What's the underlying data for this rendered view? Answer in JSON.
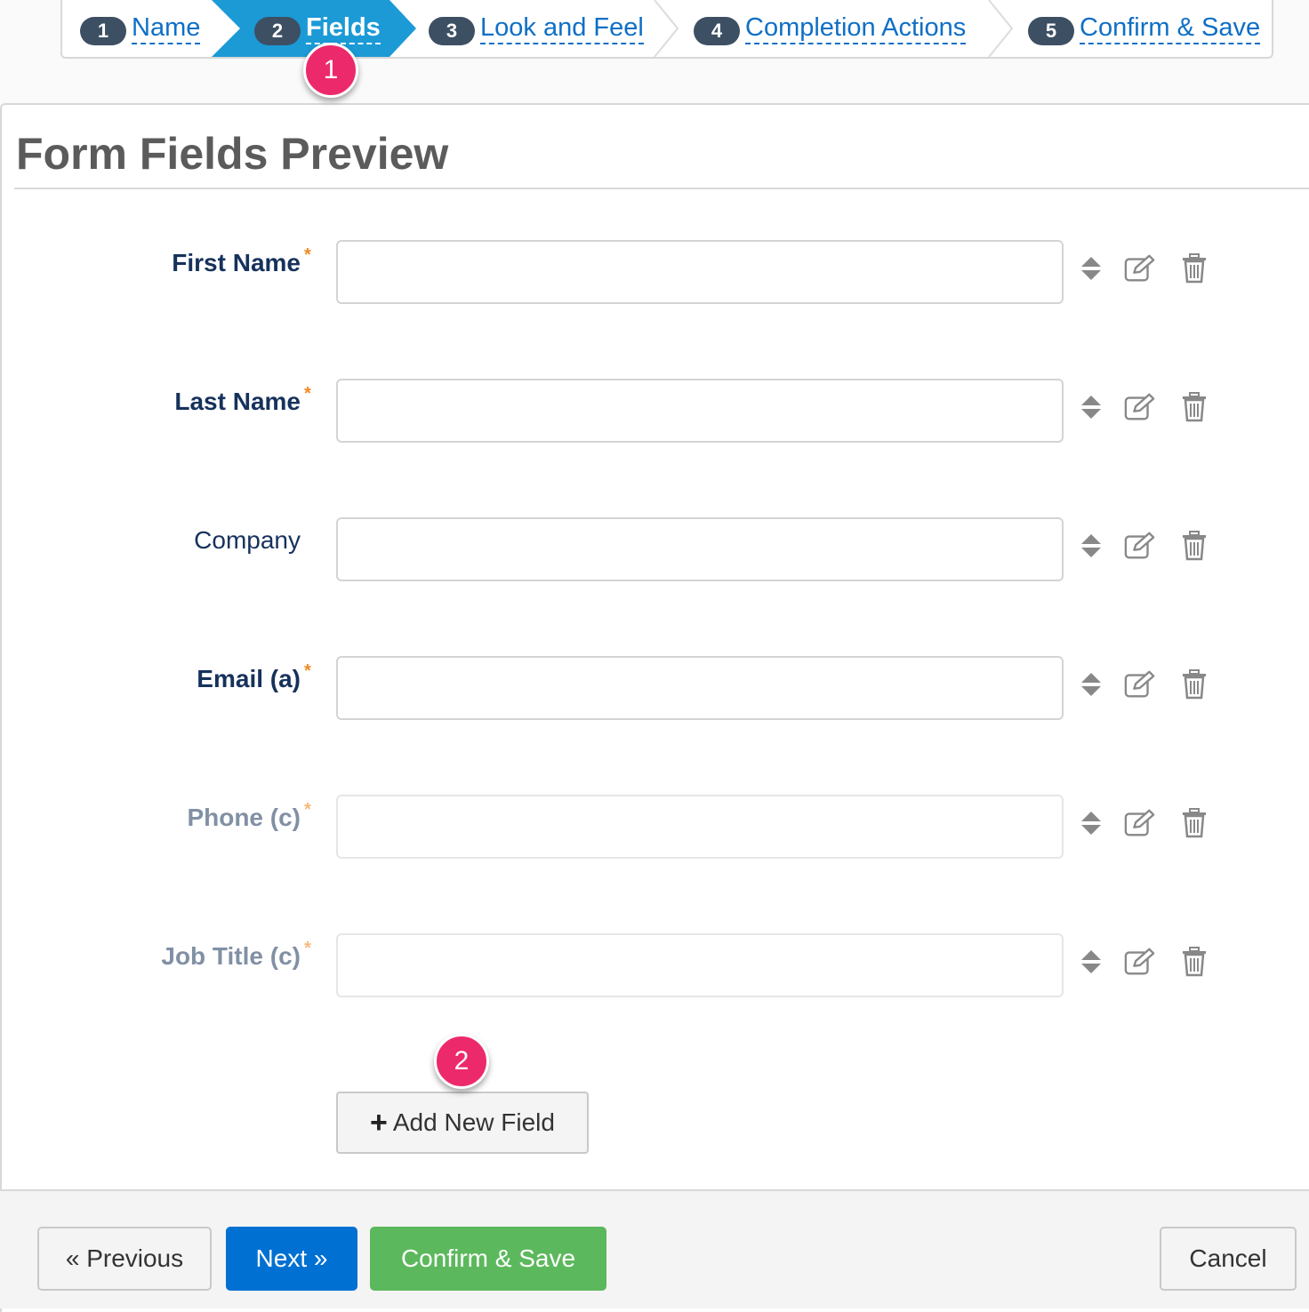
{
  "wizard": {
    "steps": [
      {
        "number": "1",
        "label": "Name"
      },
      {
        "number": "2",
        "label": "Fields"
      },
      {
        "number": "3",
        "label": "Look and Feel"
      },
      {
        "number": "4",
        "label": "Completion Actions"
      },
      {
        "number": "5",
        "label": "Confirm & Save"
      }
    ],
    "active_step": "2"
  },
  "callouts": {
    "first": "1",
    "second": "2"
  },
  "panel": {
    "title": "Form Fields Preview"
  },
  "fields": [
    {
      "label": "First Name",
      "required_mark": "*",
      "value": ""
    },
    {
      "label": "Last Name",
      "required_mark": "*",
      "value": ""
    },
    {
      "label": "Company",
      "required_mark": "",
      "value": ""
    },
    {
      "label": "Email (a)",
      "required_mark": "*",
      "value": ""
    },
    {
      "label": "Phone (c)",
      "required_mark": "*",
      "value": ""
    },
    {
      "label": "Job Title (c)",
      "required_mark": "*",
      "value": ""
    }
  ],
  "add_field": {
    "plus": "+",
    "label": "Add New Field"
  },
  "footer": {
    "previous_label": "« Previous",
    "next_label": "Next »",
    "confirm_label": "Confirm & Save",
    "cancel_label": "Cancel"
  },
  "colors": {
    "active_step": "#1b9ad6",
    "link": "#0f6fc6",
    "badge": "#3d4f63",
    "callout": "#ec2a6b",
    "next_button": "#0070d2",
    "confirm_button": "#5cb85c",
    "required_star": "#f08a24"
  }
}
